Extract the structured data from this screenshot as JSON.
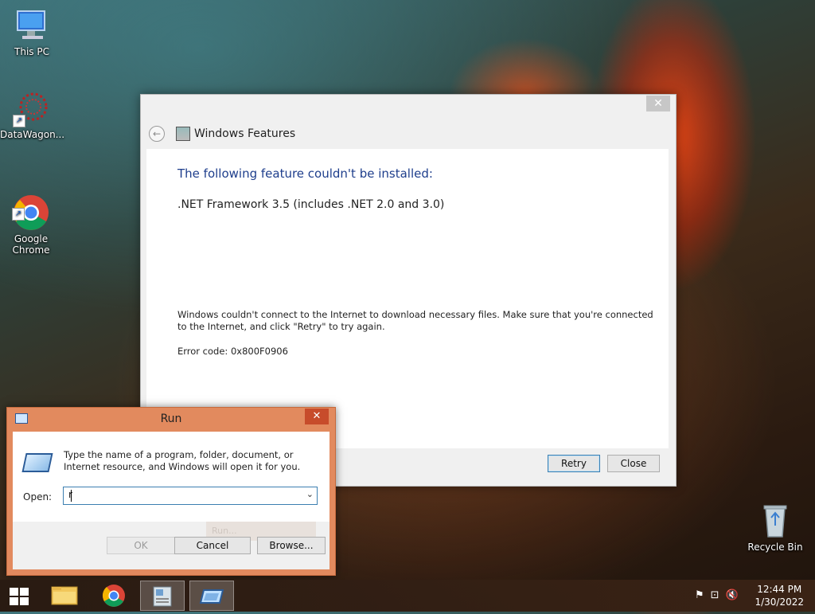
{
  "desktop": {
    "icons": [
      {
        "label": "This PC",
        "icon": "computer-icon"
      },
      {
        "label": "DataWagon...",
        "icon": "datawagon-icon"
      },
      {
        "label": "Google\nChrome",
        "icon": "chrome-icon"
      },
      {
        "label": "Recycle Bin",
        "icon": "recycle-bin-icon"
      }
    ]
  },
  "features_dialog": {
    "title": "Windows Features",
    "close_glyph": "✕",
    "back_glyph": "←",
    "heading": "The following feature couldn't be installed:",
    "feature_name": ".NET Framework 3.5 (includes .NET 2.0 and 3.0)",
    "message": "Windows couldn't connect to the Internet to download necessary files. Make sure that you're connected to the Internet, and click \"Retry\" to try again.",
    "error_code": "Error code: 0x800F0906",
    "buttons": {
      "retry": "Retry",
      "close": "Close"
    }
  },
  "run_dialog": {
    "title": "Run",
    "close_glyph": "✕",
    "description": "Type the name of a program, folder, document, or Internet resource, and Windows will open it for you.",
    "open_label": "Open:",
    "input_value": "r",
    "ghost_text": "Run...",
    "buttons": {
      "ok": "OK",
      "cancel": "Cancel",
      "browse": "Browse..."
    }
  },
  "taskbar": {
    "items": [
      "start-button",
      "file-explorer",
      "google-chrome",
      "windows-features",
      "run"
    ],
    "time": "12:44 PM",
    "date": "1/30/2022"
  },
  "colors": {
    "accent_heading": "#1e3e8c",
    "run_frame": "#e28a5e",
    "run_close": "#c74c2b"
  }
}
